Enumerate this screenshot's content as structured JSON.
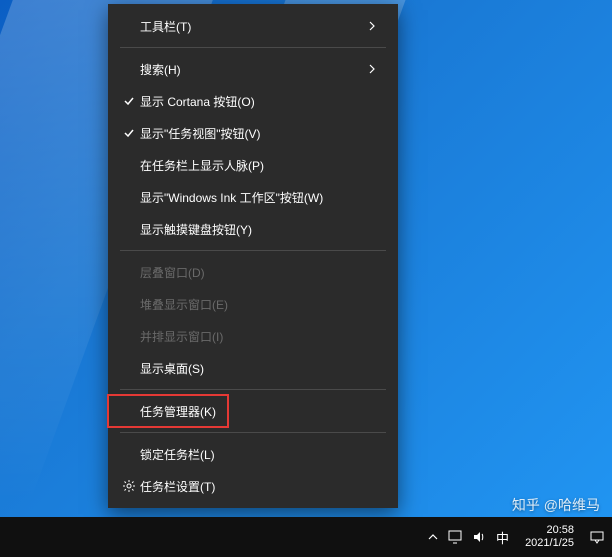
{
  "menu": {
    "items": [
      {
        "id": "toolbars",
        "label": "工具栏(T)",
        "submenu": true
      },
      {
        "separator": true
      },
      {
        "id": "search",
        "label": "搜索(H)",
        "submenu": true
      },
      {
        "id": "show-cortana",
        "label": "显示 Cortana 按钮(O)",
        "checked": true
      },
      {
        "id": "show-taskview",
        "label": "显示\"任务视图\"按钮(V)",
        "checked": true
      },
      {
        "id": "show-people",
        "label": "在任务栏上显示人脉(P)"
      },
      {
        "id": "show-ink",
        "label": "显示\"Windows Ink 工作区\"按钮(W)"
      },
      {
        "id": "show-touchkb",
        "label": "显示触摸键盘按钮(Y)"
      },
      {
        "separator": true
      },
      {
        "id": "cascade",
        "label": "层叠窗口(D)",
        "disabled": true
      },
      {
        "id": "stack",
        "label": "堆叠显示窗口(E)",
        "disabled": true
      },
      {
        "id": "sidebyside",
        "label": "并排显示窗口(I)",
        "disabled": true
      },
      {
        "id": "show-desktop",
        "label": "显示桌面(S)"
      },
      {
        "separator": true
      },
      {
        "id": "task-manager",
        "label": "任务管理器(K)",
        "highlight": true
      },
      {
        "separator": true
      },
      {
        "id": "lock-taskbar",
        "label": "锁定任务栏(L)"
      },
      {
        "id": "taskbar-settings",
        "label": "任务栏设置(T)",
        "icon": "gear"
      }
    ]
  },
  "tray": {
    "ime": "中",
    "time": "20:58",
    "date": "2021/1/25"
  },
  "watermark": "知乎 @哈维马"
}
